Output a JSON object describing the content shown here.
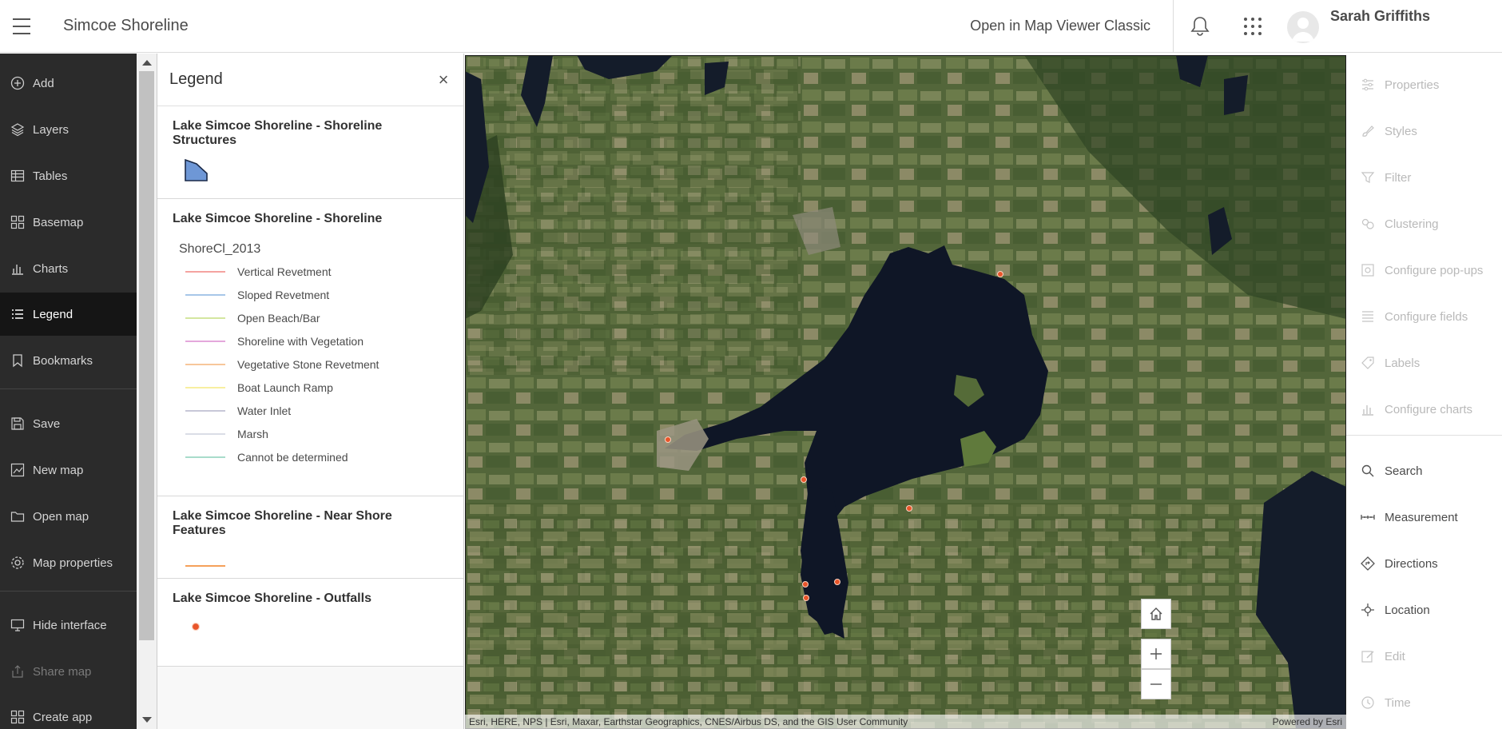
{
  "header": {
    "app_title": "Simcoe Shoreline",
    "open_classic": "Open in Map Viewer Classic",
    "user_name": "Sarah Griffiths"
  },
  "leftnav": {
    "items": [
      {
        "label": "Add",
        "icon": "plus-circle-icon"
      },
      {
        "label": "Layers",
        "icon": "layers-icon"
      },
      {
        "label": "Tables",
        "icon": "table-icon"
      },
      {
        "label": "Basemap",
        "icon": "basemap-icon"
      },
      {
        "label": "Charts",
        "icon": "chart-icon"
      },
      {
        "label": "Legend",
        "icon": "legend-icon",
        "active": true
      },
      {
        "label": "Bookmarks",
        "icon": "bookmark-icon"
      },
      {
        "label": "Save",
        "icon": "save-icon"
      },
      {
        "label": "New map",
        "icon": "new-map-icon"
      },
      {
        "label": "Open map",
        "icon": "folder-icon"
      },
      {
        "label": "Map properties",
        "icon": "gear-icon"
      },
      {
        "label": "Hide interface",
        "icon": "monitor-icon"
      },
      {
        "label": "Share map",
        "icon": "share-icon",
        "disabled": true
      },
      {
        "label": "Create app",
        "icon": "apps-icon"
      }
    ]
  },
  "legend": {
    "title": "Legend",
    "close": "×",
    "sections": [
      {
        "title": "Lake Simcoe Shoreline - Shoreline Structures"
      },
      {
        "title": "Lake Simcoe Shoreline - Shoreline",
        "field": "ShoreCl_2013",
        "classes": [
          {
            "label": "Vertical Revetment",
            "color": "#f4a3a0"
          },
          {
            "label": "Sloped Revetment",
            "color": "#a7c7e8"
          },
          {
            "label": "Open Beach/Bar",
            "color": "#d4e6a0"
          },
          {
            "label": "Shoreline with Vegetation",
            "color": "#e4a8dc"
          },
          {
            "label": "Vegetative Stone Revetment",
            "color": "#f7c79a"
          },
          {
            "label": "Boat Launch Ramp",
            "color": "#f8efa0"
          },
          {
            "label": "Water Inlet",
            "color": "#c8c8d8"
          },
          {
            "label": "Marsh",
            "color": "#dadde6"
          },
          {
            "label": "Cannot be determined",
            "color": "#a8dccb"
          }
        ]
      },
      {
        "title": "Lake Simcoe Shoreline - Near Shore Features",
        "line_color": "#f5a05a"
      },
      {
        "title": "Lake Simcoe Shoreline - Outfalls",
        "point_color": "#e8552a"
      }
    ]
  },
  "map": {
    "attribution": "Esri, HERE, NPS | Esri, Maxar, Earthstar Geographics, CNES/Airbus DS, and the GIS User Community",
    "powered_by": "Powered by Esri"
  },
  "rightbar": {
    "items": [
      {
        "label": "Properties",
        "icon": "properties-icon",
        "enabled": false
      },
      {
        "label": "Styles",
        "icon": "styles-icon",
        "enabled": false
      },
      {
        "label": "Filter",
        "icon": "filter-icon",
        "enabled": false
      },
      {
        "label": "Clustering",
        "icon": "clustering-icon",
        "enabled": false
      },
      {
        "label": "Configure pop-ups",
        "icon": "popup-icon",
        "enabled": false
      },
      {
        "label": "Configure fields",
        "icon": "fields-icon",
        "enabled": false
      },
      {
        "label": "Labels",
        "icon": "label-icon",
        "enabled": false
      },
      {
        "label": "Configure charts",
        "icon": "chart-config-icon",
        "enabled": false
      },
      {
        "label": "Search",
        "icon": "search-icon",
        "enabled": true
      },
      {
        "label": "Measurement",
        "icon": "measure-icon",
        "enabled": true
      },
      {
        "label": "Directions",
        "icon": "directions-icon",
        "enabled": true
      },
      {
        "label": "Location",
        "icon": "location-icon",
        "enabled": true
      },
      {
        "label": "Edit",
        "icon": "edit-icon",
        "enabled": false
      },
      {
        "label": "Time",
        "icon": "clock-icon",
        "enabled": false
      }
    ]
  }
}
